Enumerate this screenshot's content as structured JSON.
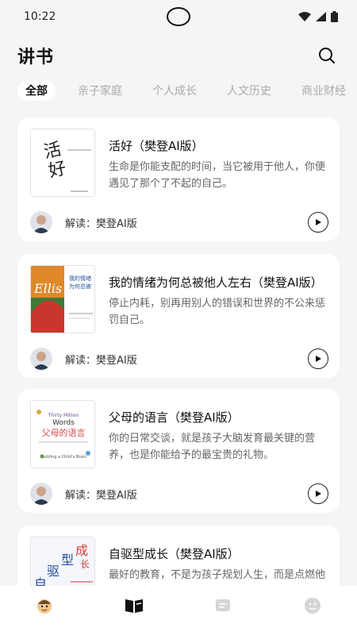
{
  "status": {
    "time": "10:22"
  },
  "header": {
    "title": "讲书"
  },
  "tabs": [
    "全部",
    "亲子家庭",
    "个人成长",
    "人文历史",
    "商业财经"
  ],
  "cards": [
    {
      "title": "活好（樊登AI版）",
      "desc": "生命是你能支配的时间，当它被用于他人，你便遇见了那个了不起的自己。",
      "reader": "解读：樊登AI版"
    },
    {
      "title": "我的情绪为何总被他人左右（樊登AI版）",
      "desc": "停止内耗，别再用别人的错误和世界的不公来惩罚自己。",
      "reader": "解读：樊登AI版"
    },
    {
      "title": "父母的语言（樊登AI版）",
      "desc": "你的日常交谈，就是孩子大脑发育最关键的营养，也是你能给予的最宝贵的礼物。",
      "reader": "解读：樊登AI版"
    },
    {
      "title": "自驱型成长（樊登AI版）",
      "desc": "最好的教育，不是为孩子规划人生，而是点燃他为自己去决的意愿。",
      "reader": ""
    }
  ],
  "colors": {
    "accent": "#111111",
    "background": "#f5f5f5",
    "card": "#ffffff"
  }
}
